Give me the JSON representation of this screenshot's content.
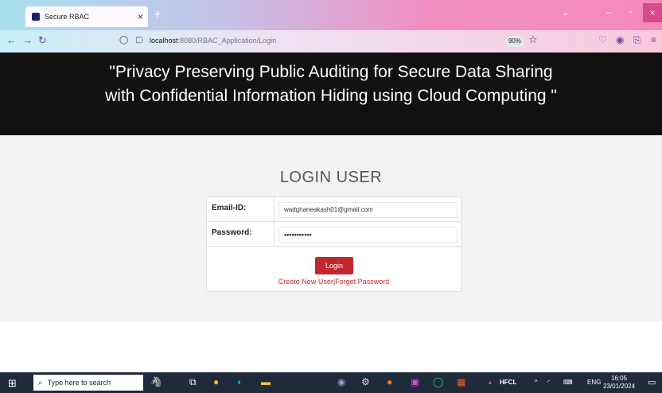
{
  "browser": {
    "tab_title": "Secure RBAC",
    "tab_close": "×",
    "new_tab": "+",
    "url_host": "localhost",
    "url_path": ":8080/RBAC_Application/Login",
    "zoom": "90%"
  },
  "page": {
    "hero_title_line1": "\"Privacy Preserving Public Auditing for Secure Data Sharing",
    "hero_title_line2": "with Confidential Information Hiding using Cloud Computing \"",
    "login_heading": "LOGIN USER",
    "form": {
      "email_label": "Email-ID:",
      "email_value": "wadghaneakash01@gmail.com",
      "password_label": "Password:",
      "password_value": "•••••••••••",
      "login_label": "Login",
      "create_link": "Create New User",
      "link_separator": "|",
      "forget_link": "Forget Password"
    }
  },
  "taskbar": {
    "search_placeholder": "Type here to search",
    "hfcl": "HFCL",
    "lang": "ENG",
    "time": "16:05",
    "date": "23/01/2024"
  },
  "colors": {
    "accent_red": "#c0282d",
    "hero_bg": "#111111"
  }
}
